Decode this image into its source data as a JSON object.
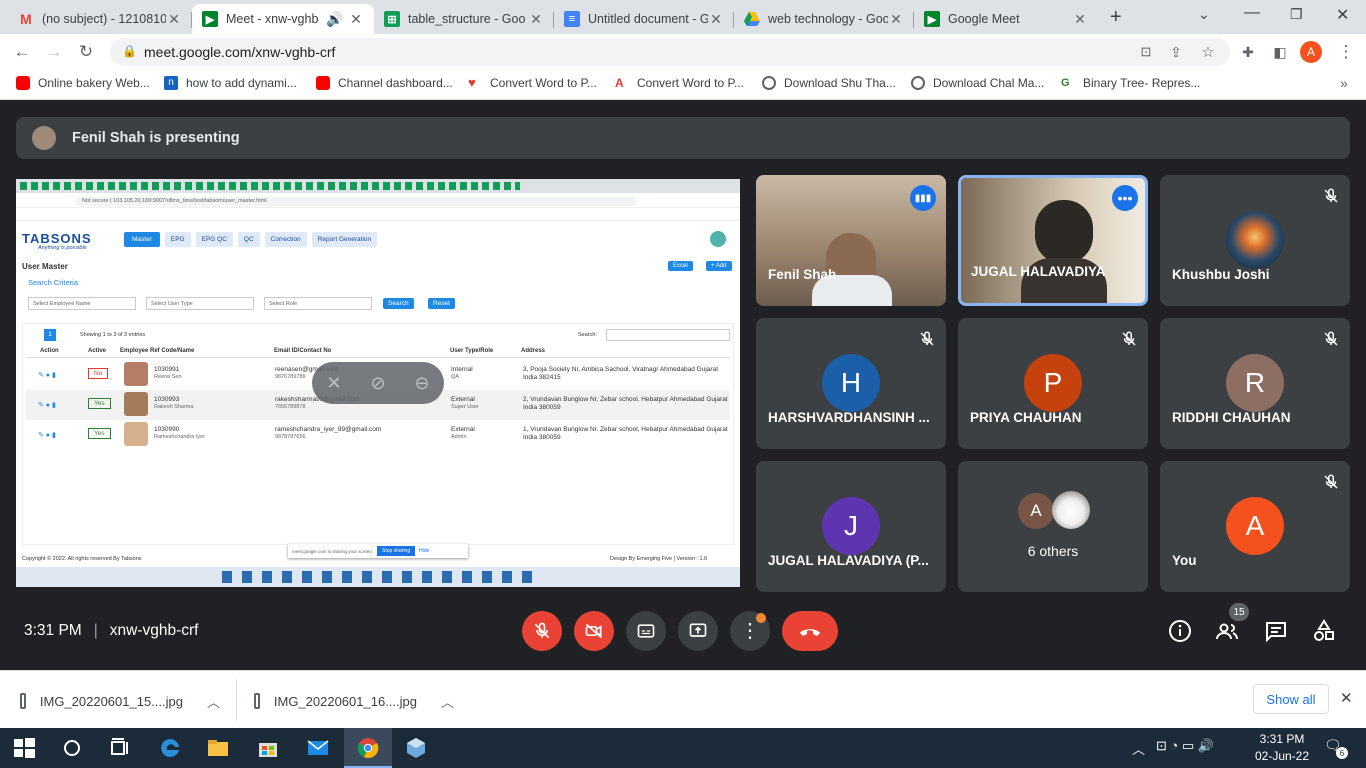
{
  "browser": {
    "tabs": [
      {
        "label": "(no subject) - 1210810",
        "icon": "gmail-icon",
        "active": false
      },
      {
        "label": "Meet - xnw-vghb",
        "icon": "meet-icon",
        "active": true
      },
      {
        "label": "table_structure - Goo",
        "icon": "sheets-icon",
        "active": false
      },
      {
        "label": "Untitled document - G",
        "icon": "docs-icon",
        "active": false
      },
      {
        "label": "web technology - Goo",
        "icon": "drive-icon",
        "active": false
      },
      {
        "label": "Google Meet",
        "icon": "meet-icon",
        "active": false
      }
    ],
    "url": "meet.google.com/xnw-vghb-crf",
    "profile_initial": "A",
    "bookmarks": [
      {
        "label": "Online bakery Web...",
        "icon": "youtube-icon"
      },
      {
        "label": "how to add dynami...",
        "icon": "n-icon"
      },
      {
        "label": "Channel dashboard...",
        "icon": "youtube-icon"
      },
      {
        "label": "Convert Word to P...",
        "icon": "heart-icon"
      },
      {
        "label": "Convert Word to P...",
        "icon": "adobe-icon"
      },
      {
        "label": "Download Shu Tha...",
        "icon": "globe-icon"
      },
      {
        "label": "Download Chal Ma...",
        "icon": "globe-icon"
      },
      {
        "label": "Binary Tree- Repres...",
        "icon": "gfg-icon"
      }
    ]
  },
  "meet": {
    "presenting_text": "Fenil Shah is presenting",
    "meeting_time": "3:31 PM",
    "meeting_code": "xnw-vghb-crf",
    "participant_count": "15",
    "tiles": [
      {
        "name": "Fenil Shah",
        "type": "video"
      },
      {
        "name": "JUGAL HALAVADIYA",
        "type": "video"
      },
      {
        "name": "Khushbu Joshi",
        "type": "image"
      },
      {
        "name": "HARSHVARDHANSINH ...",
        "initial": "H",
        "color": "#1a5fa8"
      },
      {
        "name": "PRIYA CHAUHAN",
        "initial": "P",
        "color": "#c5420f"
      },
      {
        "name": "RIDDHI CHAUHAN",
        "initial": "R",
        "color": "#8d6e63"
      },
      {
        "name": "JUGAL HALAVADIYA (P...",
        "initial": "J",
        "color": "#5e35b1"
      },
      {
        "name": "6 others",
        "initial": "A",
        "color": "#795548"
      },
      {
        "name": "You",
        "initial": "A",
        "color": "#f4511e"
      }
    ]
  },
  "shared": {
    "brand": "TABSONS",
    "tagline": "Anything is possible",
    "nav": [
      "Master",
      "EPG",
      "EPG QC",
      "QC",
      "Correction",
      "Report Generation"
    ],
    "page_title": "User Master",
    "excel_label": "Excel",
    "add_label": "+ Add",
    "search_criteria": "Search Criteria",
    "filters": [
      "Select Employee Name",
      "Select User Type",
      "Select Role"
    ],
    "search_btn": "Search",
    "reset_btn": "Reset",
    "entries_info": "Showing 1 to 3 of 3 entries",
    "page_num": "1",
    "search_label": "Search:",
    "columns": [
      "Action",
      "Active",
      "Employee Ref Code/Name",
      "Email ID/Contact No",
      "User Type/Role",
      "Address"
    ],
    "rows": [
      {
        "active": "No",
        "code": "1030991",
        "name": "Reena Sen",
        "email": "reenasen@gmail.com",
        "phone": "9876789789",
        "type": "Internal",
        "role": "QA",
        "address": "3, Pooja Society Nr. Ambica Sachool, Viratnagr Ahmedabad Gujarat India 382415"
      },
      {
        "active": "Yes",
        "code": "1030993",
        "name": "Rakesh Sharma",
        "email": "rakeshsharma99@gmail.com",
        "phone": "7656789878",
        "type": "External",
        "role": "Super User",
        "address": "2, Vrundavan Bunglow Nr. Zebar school, Hebatpur Ahmedabad Gujarat India 380059"
      },
      {
        "active": "Yes",
        "code": "1030990",
        "name": "Rameshchandra Iyer",
        "email": "rameshchandra_iyer_99@gmail.com",
        "phone": "9878787656",
        "type": "External",
        "role": "Admin",
        "address": "1, Vrundavan Bunglow Nr. Zebar school, Hebatpur Ahmedabad Gujarat India 380059"
      }
    ],
    "footer_left": "Copyright © 2022. All rights reserved By Tabsons",
    "footer_right": "Design By Emerging Five | Version : 1.0",
    "sharing_text": "meet.google.com is sharing your screen.",
    "stop_sharing": "Stop sharing",
    "hide": "Hide",
    "inner_url": "Not secure | 103.105.20.169:9007/uflms_tims/test/tabsom/user_master.html"
  },
  "downloads": [
    {
      "name": "IMG_20220601_15....jpg"
    },
    {
      "name": "IMG_20220601_16....jpg"
    }
  ],
  "show_all": "Show all",
  "taskbar": {
    "time": "3:31 PM",
    "date": "02-Jun-22",
    "notifications": "6"
  }
}
